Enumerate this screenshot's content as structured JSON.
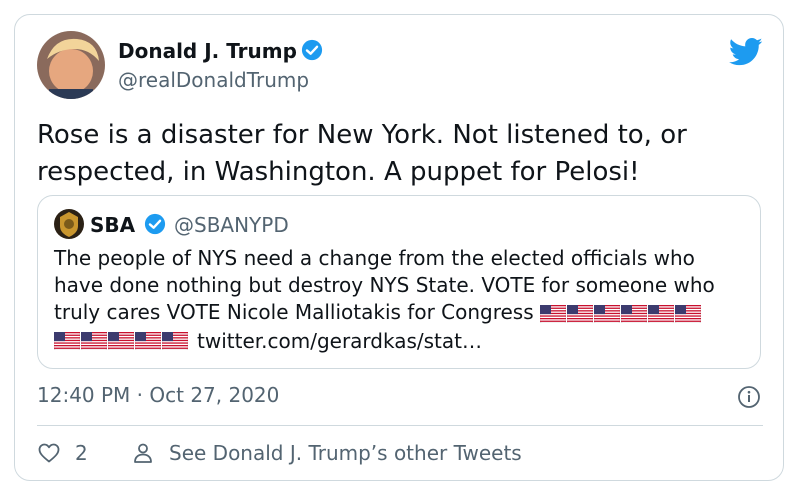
{
  "tweet": {
    "author": {
      "name": "Donald J. Trump",
      "handle": "@realDonaldTrump",
      "verified": true
    },
    "text_line1": "Rose is a disaster for New York. Not listened to, or",
    "text_line2": "respected, in Washington. A puppet for Pelosi!",
    "timestamp": "12:40 PM · Oct 27, 2020",
    "like_count": "2",
    "profile_link": "See Donald J. Trump’s other Tweets"
  },
  "quoted_tweet": {
    "name": "SBA",
    "handle": "@SBANYPD",
    "verified": true,
    "text_line1": "The people of NYS need a change from the elected officials who",
    "text_line2": "have done nothing but destroy NYS State. VOTE for someone who",
    "text_line3": "truly cares VOTE Nicole Malliotakis for Congress",
    "link": "twitter.com/gerardkas/stat…",
    "flag_emoji": "🇺🇸",
    "flags_line3": 6,
    "flags_line4": 5
  },
  "icons": {
    "brand": "twitter-bird-icon",
    "verified": "verified-badge-icon",
    "info": "info-icon",
    "like": "heart-icon",
    "profile": "person-icon"
  },
  "colors": {
    "brand_blue": "#1d9bf0",
    "text_primary": "#0f1419",
    "text_secondary": "#536471",
    "border": "#cfd9de"
  }
}
